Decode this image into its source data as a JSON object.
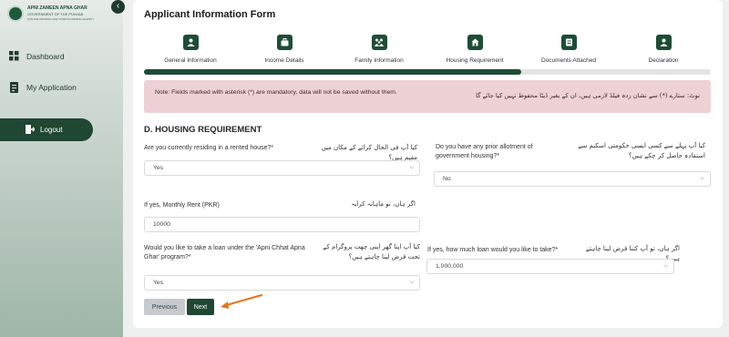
{
  "brand": {
    "line1": "APNI ZAMEEN APNA GHAR",
    "line2": "GOVERNMENT OF THE PUNJAB",
    "line3": "PUNJAB HOUSING AND TOWN PLANNING AGENCY"
  },
  "sidebar": {
    "collapse_glyph": "‹",
    "items": [
      {
        "label": "Dashboard",
        "icon": "grid-icon"
      },
      {
        "label": "My Application",
        "icon": "document-icon"
      }
    ],
    "logout_label": "Logout"
  },
  "page_title": "Applicant Information Form",
  "steps": [
    {
      "label": "General Information",
      "icon": "person-icon"
    },
    {
      "label": "Income Details",
      "icon": "briefcase-icon"
    },
    {
      "label": "Family Information",
      "icon": "family-icon"
    },
    {
      "label": "Housing Requirement",
      "icon": "home-icon"
    },
    {
      "label": "Documents Attached",
      "icon": "document-icon"
    },
    {
      "label": "Declaration",
      "icon": "person-icon"
    }
  ],
  "progress": {
    "completed_fraction": 0.666
  },
  "note": {
    "en": "Note: Fields marked with asterisk (*) are mandatory, data will not be saved without them.",
    "ur": "نوٹ: ستارے (*) سے نشان زدہ فیلڈ لازمی ہیں، ان کے بغیر ڈیٹا محفوظ نہیں کیا جائے گا"
  },
  "section_title": "D. HOUSING REQUIREMENT",
  "fields": {
    "rented": {
      "label_en": "Are you currently residing in a rented house?*",
      "label_ur": "کیا آپ فی الحال کرائے کے مکان میں مقیم ہیں؟",
      "value": "Yes"
    },
    "prior_allotment": {
      "label_en": "Do you have any prior allotment of government housing?*",
      "label_ur": "کیا آپ پہلے سے کسی ایسی حکومتی اسکیم سے استفادہ حاصل کر چکے ہیں؟",
      "value": "No"
    },
    "monthly_rent": {
      "label_en": "If yes, Monthly Rent (PKR)",
      "label_ur": "اگر ہاں، تو ماہانہ کرایہ",
      "value": "10000"
    },
    "loan": {
      "label_en": "Would you like to take a loan under the 'Apni Chhat Apna Ghar' program?*",
      "label_ur": "کیا آپ اپنا گھر اپنی چھت پروگرام کے تحت قرض لینا چاہتے ہیں؟",
      "value": "Yes"
    },
    "loan_amount": {
      "label_en": "If yes, how much loan would you like to take?*",
      "label_ur": "اگر ہاں، تو آپ کتنا قرض لینا چاہتے ہیں؟",
      "value": "1,000,000"
    }
  },
  "buttons": {
    "previous": "Previous",
    "next": "Next"
  },
  "colors": {
    "brand_green": "#1e4d36",
    "note_background": "#edd1d5",
    "annotation_arrow": "#e8731c"
  }
}
